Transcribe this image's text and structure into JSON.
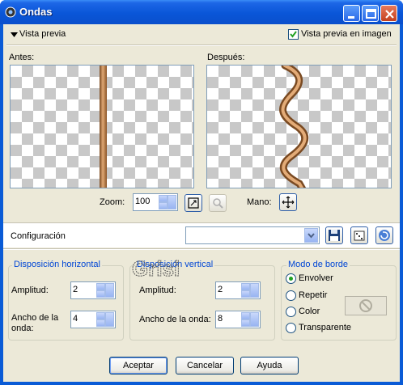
{
  "window": {
    "title": "Ondas"
  },
  "preview": {
    "toggle_label": "Vista previa",
    "in_image_label": "Vista previa en imagen",
    "in_image_checked": true,
    "before_label": "Antes:",
    "after_label": "Después:",
    "zoom_label": "Zoom:",
    "zoom_value": "100",
    "pan_label": "Mano:"
  },
  "config": {
    "label": "Configuración",
    "preset_value": ""
  },
  "horizontal": {
    "title": "Disposición horizontal",
    "amplitude_label": "Amplitud:",
    "amplitude_value": "2",
    "wavelength_label": "Ancho de la onda:",
    "wavelength_value": "4"
  },
  "vertical": {
    "title": "Disposición vertical",
    "amplitude_label": "Amplitud:",
    "amplitude_value": "2",
    "wavelength_label": "Ancho de la onda:",
    "wavelength_value": "8"
  },
  "edge": {
    "title": "Modo de borde",
    "options": [
      "Envolver",
      "Repetir",
      "Color",
      "Transparente"
    ],
    "selected": "Envolver"
  },
  "buttons": {
    "ok": "Aceptar",
    "cancel": "Cancelar",
    "help": "Ayuda"
  },
  "colors": {
    "titlebar": "#0a56d8",
    "dialog_bg": "#ece9d8",
    "group_title": "#0046d5",
    "rope": "#b97a45"
  },
  "watermark": "Grisi"
}
